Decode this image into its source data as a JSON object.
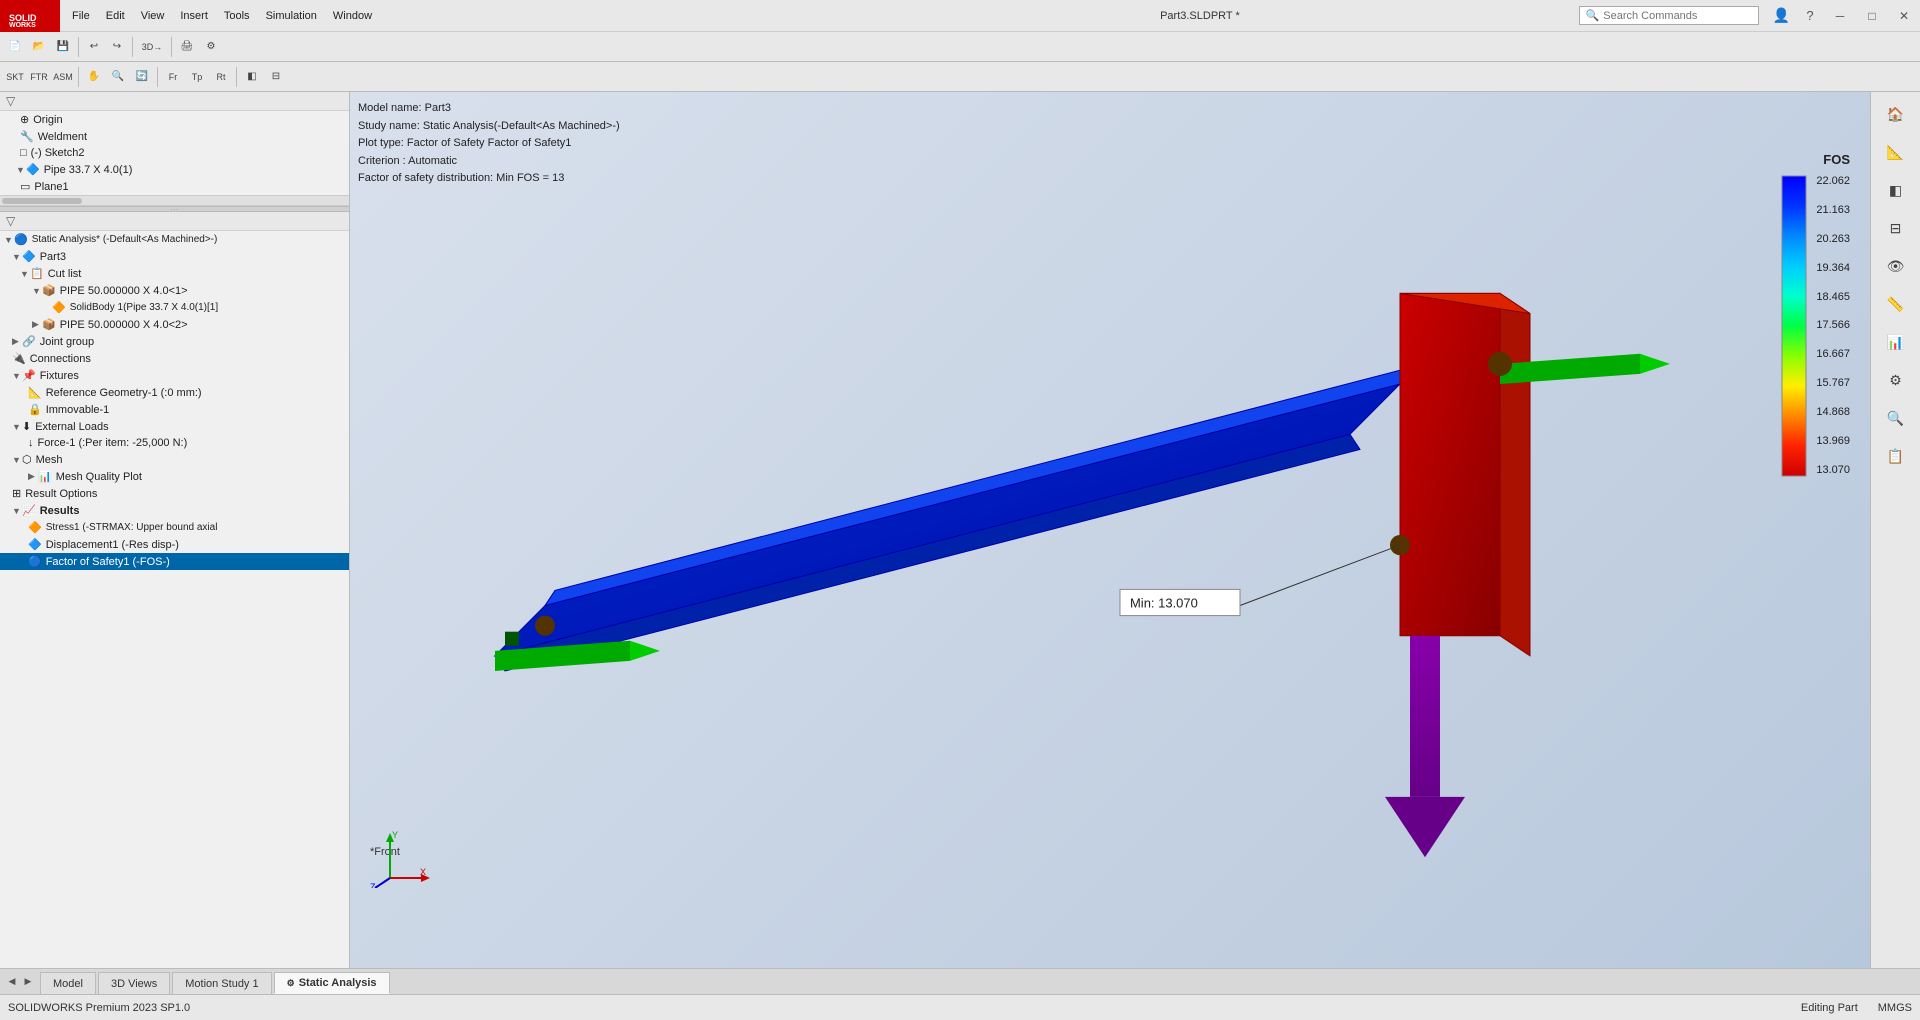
{
  "titlebar": {
    "logo": "SW",
    "menus": [
      "File",
      "Edit",
      "View",
      "Insert",
      "Tools",
      "Simulation",
      "Window"
    ],
    "title": "Part3.SLDPRT *",
    "search_placeholder": "Search Commands",
    "search_label": "Search Commands"
  },
  "model_info": {
    "model_name": "Model name: Part3",
    "study_name": "Study name: Static Analysis(-Default<As Machined>-)",
    "plot_type": "Plot type: Factor of Safety Factor of Safety1",
    "criterion": "Criterion : Automatic",
    "fos_distribution": "Factor of safety distribution: Min FOS = 13"
  },
  "legend": {
    "title": "FOS",
    "values": [
      "22.062",
      "21.163",
      "20.263",
      "19.364",
      "18.465",
      "17.566",
      "16.667",
      "15.767",
      "14.868",
      "13.969",
      "13.070"
    ],
    "colors": [
      "#0000ff",
      "#0033ff",
      "#0088ff",
      "#00ccff",
      "#00ffcc",
      "#00ff44",
      "#88ff00",
      "#ffee00",
      "#ff8800",
      "#ff2200",
      "#cc0000"
    ]
  },
  "annotation": {
    "min_label": "Min: 13.070"
  },
  "front_label": "*Front",
  "tree": {
    "study": "Static Analysis* (-Default<As Machined>-)",
    "items": [
      {
        "label": "Part3",
        "level": 1,
        "type": "part",
        "expanded": true
      },
      {
        "label": "Cut list",
        "level": 2,
        "type": "cutlist",
        "expanded": true
      },
      {
        "label": "PIPE 50.000000 X 4.0<1>",
        "level": 3,
        "type": "pipe",
        "expanded": true
      },
      {
        "label": "SolidBody 1(Pipe 33.7 X 4.0(1)[1]",
        "level": 4,
        "type": "solidbody"
      },
      {
        "label": "PIPE 50.000000 X 4.0<2>",
        "level": 3,
        "type": "pipe"
      },
      {
        "label": "Joint group",
        "level": 2,
        "type": "joint"
      },
      {
        "label": "Connections",
        "level": 2,
        "type": "connections"
      },
      {
        "label": "Fixtures",
        "level": 2,
        "type": "fixture",
        "expanded": true
      },
      {
        "label": "Reference Geometry-1 (:0 mm:)",
        "level": 3,
        "type": "ref-geometry"
      },
      {
        "label": "Immovable-1",
        "level": 3,
        "type": "immovable"
      },
      {
        "label": "External Loads",
        "level": 2,
        "type": "ext-loads",
        "expanded": true
      },
      {
        "label": "Force-1 (:Per item: -25,000 N:)",
        "level": 3,
        "type": "force"
      },
      {
        "label": "Mesh",
        "level": 2,
        "type": "mesh",
        "expanded": true
      },
      {
        "label": "Mesh Quality Plot",
        "level": 3,
        "type": "mesh-plot"
      },
      {
        "label": "Result Options",
        "level": 2,
        "type": "result-options"
      },
      {
        "label": "Results",
        "level": 2,
        "type": "results",
        "expanded": true
      },
      {
        "label": "Stress1 (-STRMAX: Upper bound axial",
        "level": 3,
        "type": "stress"
      },
      {
        "label": "Displacement1 (-Res disp-)",
        "level": 3,
        "type": "displacement"
      },
      {
        "label": "Factor of Safety1 (-FOS-)",
        "level": 3,
        "type": "fos",
        "selected": true
      }
    ]
  },
  "feature_tree_header": {
    "items": [
      {
        "label": "Origin"
      },
      {
        "label": "Weldment"
      },
      {
        "label": "(-) Sketch2"
      },
      {
        "label": "Pipe 33.7 X 4.0(1)"
      },
      {
        "label": "Plane1"
      }
    ]
  },
  "bottom_tabs": {
    "nav_prev": "◀",
    "nav_next": "▶",
    "tabs": [
      {
        "label": "Model",
        "active": false
      },
      {
        "label": "3D Views",
        "active": false
      },
      {
        "label": "Motion Study 1",
        "active": false
      },
      {
        "label": "Static Analysis",
        "active": true
      }
    ]
  },
  "statusbar": {
    "left": "SOLIDWORKS Premium 2023 SP1.0",
    "editing": "Editing Part",
    "units": "MMGS"
  },
  "right_panel_icons": [
    "🏠",
    "📐",
    "📋",
    "📁",
    "📊",
    "🔧",
    "🔷",
    "🔶",
    "⚙️",
    "📌",
    "🔍",
    "⊞",
    "🅰",
    "🔗"
  ]
}
